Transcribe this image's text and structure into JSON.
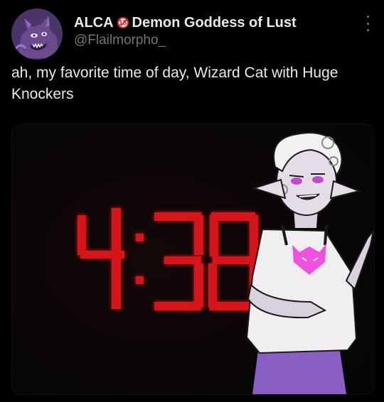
{
  "post": {
    "author": {
      "display_name_prefix": "ALCA",
      "badge_text": "18",
      "display_name_suffix": "Demon Goddess of Lust",
      "handle": "@Flailmorpho_",
      "avatar_icon": "purple-demon-cat-avatar"
    },
    "text": "ah, my favorite time of day, Wizard Cat with Huge Knockers",
    "media": {
      "clock_reading": "4:38",
      "clock_color": "#e0141c"
    },
    "more_icon": "vertical-ellipsis-icon"
  },
  "colors": {
    "background": "#000000",
    "text_primary": "#e7e9ea",
    "text_secondary": "#71767b",
    "shirt_emblem": "#f050e0",
    "skirt": "#8a5fc4"
  }
}
